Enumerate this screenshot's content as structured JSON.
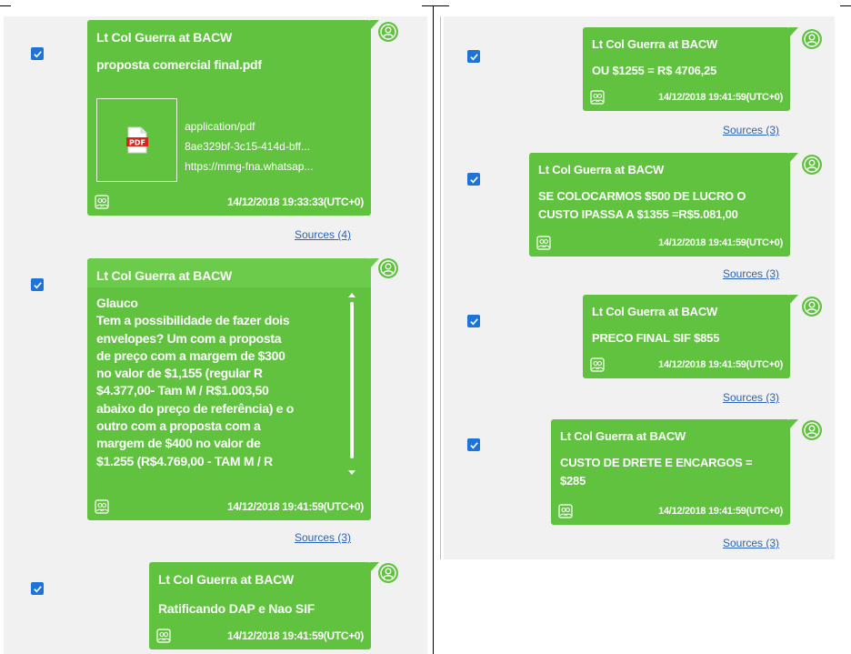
{
  "messages": [
    {
      "sender": "Lt Col Guerra at BACW",
      "text": "proposta comercial final.pdf",
      "attachment": {
        "type_icon": "pdf-icon",
        "icon_label": "PDF",
        "mime": "application/pdf",
        "id": "8ae329bf-3c15-414d-bff...",
        "url": "https://mmg-fna.whatsap..."
      },
      "timestamp": "14/12/2018 19:33:33(UTC+0)",
      "sources": "Sources (4)",
      "checked": true
    },
    {
      "sender": "Lt Col Guerra at BACW",
      "text_lines": [
        "Glauco",
        "Tem a possibilidade de fazer dois",
        "envelopes? Um com a proposta",
        "de preço com a margem de $300",
        "no valor de $1,155 (regular R",
        "$4.377,00- Tam M / R$1.003,50",
        "abaixo do preço de referência) e o",
        "outro com a proposta com a",
        "margem de $400 no valor de",
        "$1.255 (R$4.769,00 - TAM M / R"
      ],
      "timestamp": "14/12/2018 19:41:59(UTC+0)",
      "sources": "Sources (3)",
      "checked": true
    },
    {
      "sender": "Lt Col Guerra at BACW",
      "text": "Ratificando DAP e Nao SIF",
      "timestamp": "14/12/2018 19:41:59(UTC+0)",
      "checked": true
    },
    {
      "sender": "Lt Col Guerra at BACW",
      "text": "OU $1255 = R$ 4706,25",
      "timestamp": "14/12/2018 19:41:59(UTC+0)",
      "sources": "Sources (3)",
      "checked": true
    },
    {
      "sender": "Lt Col Guerra at BACW",
      "text_lines": [
        "SE COLOCARMOS $500 DE LUCRO O",
        "CUSTO IPASSA A $1355 =R$5.081,00"
      ],
      "timestamp": "14/12/2018 19:41:59(UTC+0)",
      "sources": "Sources (3)",
      "checked": true
    },
    {
      "sender": "Lt Col Guerra at BACW",
      "text": "PRECO FINAL SIF $855",
      "timestamp": "14/12/2018 19:41:59(UTC+0)",
      "sources": "Sources (3)",
      "checked": true
    },
    {
      "sender": "Lt Col Guerra at BACW",
      "text_lines": [
        "CUSTO DE DRETE E ENCARGOS =",
        "$285"
      ],
      "timestamp": "14/12/2018 19:41:59(UTC+0)",
      "sources": "Sources (3)",
      "checked": true
    }
  ],
  "colors": {
    "bubble": "#60c23f",
    "bubble_header": "#6ccb4a",
    "checkbox": "#1e74d6",
    "link": "#2b63b7",
    "panel": "#f1f1f1"
  }
}
